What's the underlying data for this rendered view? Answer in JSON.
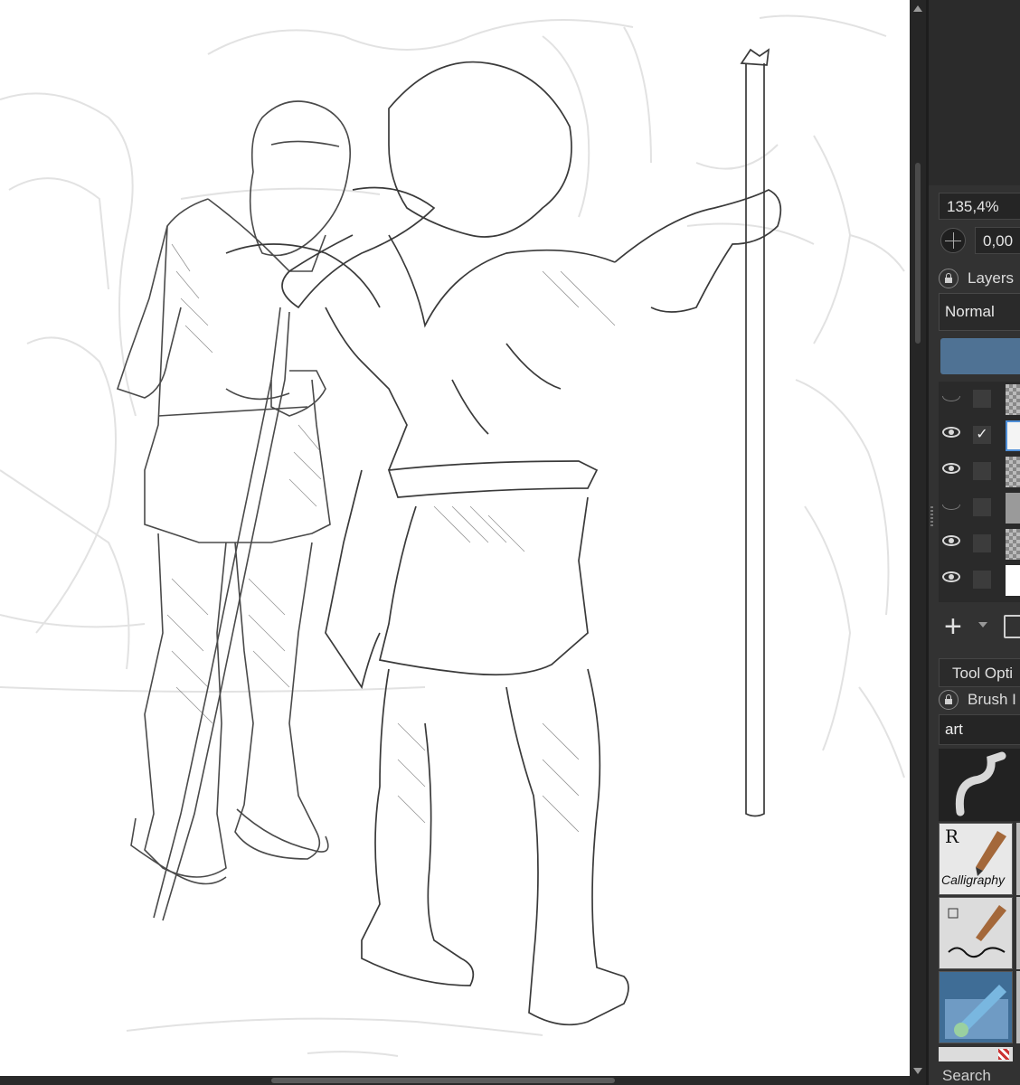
{
  "canvas": {
    "artwork": "pencil-drawing-two-figures"
  },
  "panel": {
    "zoom_value": "135,4%",
    "rotation_value": "0,00",
    "layers_label": "Layers",
    "blend_mode": "Normal",
    "layers": [
      {
        "visible": false,
        "checked": false,
        "thumb": "checker"
      },
      {
        "visible": true,
        "checked": true,
        "thumb": "sketch",
        "selected": true
      },
      {
        "visible": true,
        "checked": false,
        "thumb": "checker"
      },
      {
        "visible": false,
        "checked": false,
        "thumb": "grey"
      },
      {
        "visible": true,
        "checked": false,
        "thumb": "checker"
      },
      {
        "visible": true,
        "checked": false,
        "thumb": "white"
      }
    ],
    "checkmark": "✓",
    "add_layer_label": "+",
    "tool_options_label": "Tool Opti",
    "brush_label": "Brush I",
    "preset_filter": "art",
    "preset_calligraphy_text": "Calligraphy",
    "preset_r_text": "R",
    "search_label": "Search"
  },
  "colors": {
    "accent": "#4f7294",
    "panel_bg": "#323232"
  }
}
